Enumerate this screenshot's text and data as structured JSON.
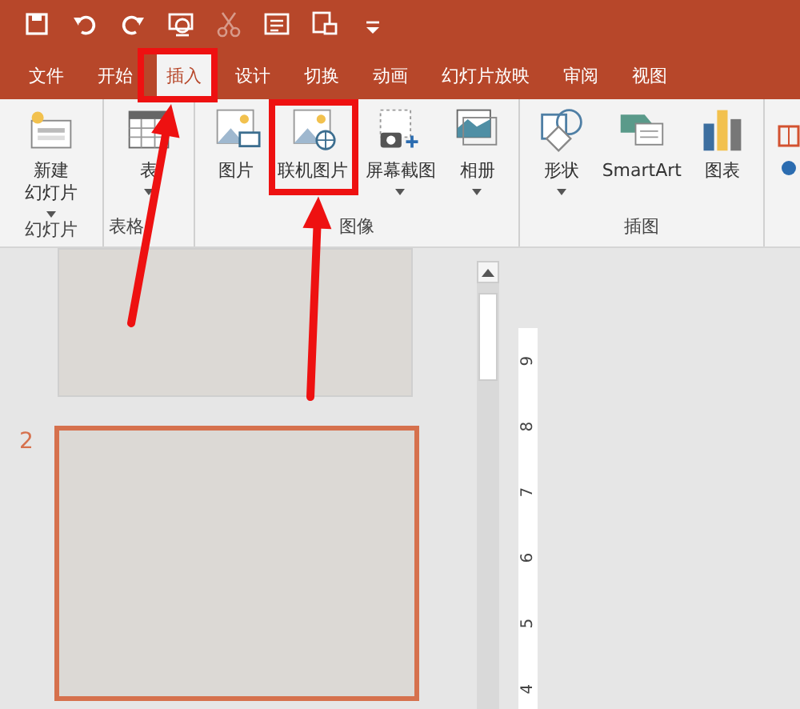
{
  "quick_access": [
    {
      "kind": "save",
      "disabled": false
    },
    {
      "kind": "undo",
      "disabled": false
    },
    {
      "kind": "redo",
      "disabled": false
    },
    {
      "kind": "present",
      "disabled": false
    },
    {
      "kind": "cut",
      "disabled": true
    },
    {
      "kind": "layout",
      "disabled": false
    },
    {
      "kind": "screen",
      "disabled": false
    },
    {
      "kind": "customize",
      "disabled": false
    }
  ],
  "tabs": [
    {
      "label": "文件",
      "selected": false
    },
    {
      "label": "开始",
      "selected": false
    },
    {
      "label": "插入",
      "selected": true
    },
    {
      "label": "设计",
      "selected": false
    },
    {
      "label": "切换",
      "selected": false
    },
    {
      "label": "动画",
      "selected": false
    },
    {
      "label": "幻灯片放映",
      "selected": false
    },
    {
      "label": "审阅",
      "selected": false
    },
    {
      "label": "视图",
      "selected": false
    }
  ],
  "ribbon_groups": [
    {
      "label": "幻灯片",
      "items": [
        {
          "kind": "new-slide",
          "label": [
            "新建",
            "幻灯片"
          ],
          "dropdown": true
        }
      ]
    },
    {
      "label": "表格",
      "items": [
        {
          "kind": "table",
          "label": "表",
          "dropdown": true
        }
      ]
    },
    {
      "label": "图像",
      "items": [
        {
          "kind": "picture",
          "label": "图片",
          "dropdown": false
        },
        {
          "kind": "online-picture",
          "label": "联机图片",
          "dropdown": false
        },
        {
          "kind": "screenshot",
          "label": "屏幕截图",
          "dropdown": true
        },
        {
          "kind": "album",
          "label": "相册",
          "dropdown": true
        }
      ]
    },
    {
      "label": "插图",
      "items": [
        {
          "kind": "shapes",
          "label": "形状",
          "dropdown": true
        },
        {
          "kind": "smartart",
          "label": "SmartArt",
          "dropdown": false
        },
        {
          "kind": "chart",
          "label": "图表",
          "dropdown": false
        }
      ]
    }
  ],
  "slides": [
    {
      "selected": false
    },
    {
      "number": "2",
      "selected": true
    }
  ],
  "ruler_labels": [
    "9",
    "8",
    "7",
    "6",
    "5",
    "4"
  ],
  "annotations": [
    {
      "kind": "box"
    },
    {
      "kind": "box"
    },
    {
      "kind": "arrow"
    },
    {
      "kind": "arrow"
    }
  ]
}
